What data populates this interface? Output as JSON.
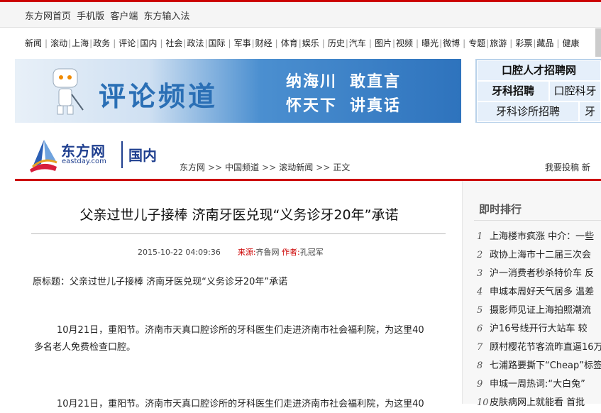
{
  "topbar": {
    "links": [
      "东方网首页",
      "手机版",
      "客户端",
      "东方输入法"
    ]
  },
  "nav": {
    "groups": [
      [
        "新闻"
      ],
      [
        "滚动",
        "上海",
        "政务"
      ],
      [
        "评论",
        "国内"
      ],
      [
        "社会",
        "政法",
        "国际"
      ],
      [
        "军事",
        "财经"
      ],
      [
        "体育",
        "娱乐"
      ],
      [
        "历史",
        "汽车"
      ],
      [
        "图片",
        "视频"
      ],
      [
        "曝光",
        "微博"
      ],
      [
        "专题",
        "旅游"
      ],
      [
        "彩票",
        "藏品"
      ],
      [
        "健康"
      ]
    ]
  },
  "banner": {
    "title": "评论频道",
    "slogan_line1_a": "纳海川",
    "slogan_line1_b": "敢直言",
    "slogan_line2_a": "怀天下",
    "slogan_line2_b": "讲真话"
  },
  "ads": {
    "row1": "口腔人才招聘网",
    "row2a": "牙科招聘",
    "row2b": "口腔科牙",
    "row3a": "牙科诊所招聘",
    "row3b": "牙"
  },
  "logo": {
    "name": "东方网",
    "domain": "eastday.com",
    "channel": "国内"
  },
  "breadcrumb": [
    "东方网",
    "中国频道",
    "滚动新闻",
    "正文"
  ],
  "submit_label": "我要投稿",
  "submit_tail": "新",
  "article": {
    "headline": "父亲过世儿子接棒 济南牙医兑现“义务诊牙20年”承诺",
    "date": "2015-10-22 04:09:36",
    "source_label": "来源:",
    "source": "齐鲁网",
    "author_label": "作者:",
    "author": "孔冠军",
    "original_title": "原标题：父亲过世儿子接棒 济南牙医兑现“义务诊牙20年”承诺",
    "para1_line1": "10月21日，重阳节。济南市天真口腔诊所的牙科医生们走进济南市社会福利院，为这里40",
    "para1_line2": "多名老人免费检查口腔。",
    "para2_line1": "10月21日，重阳节。济南市天真口腔诊所的牙科医生们走进济南市社会福利院，为这里40"
  },
  "sidebar": {
    "title": "即时排行",
    "items": [
      {
        "num": "1",
        "text": "上海楼市疯涨 中介：一些"
      },
      {
        "num": "2",
        "text": "政协上海市十二届三次会"
      },
      {
        "num": "3",
        "text": "沪一消费者秒杀特价车 反"
      },
      {
        "num": "4",
        "text": "申城本周好天气居多 温差"
      },
      {
        "num": "5",
        "text": "摄影师见证上海拍照潮流"
      },
      {
        "num": "6",
        "text": "沪16号线开行大站车 较"
      },
      {
        "num": "7",
        "text": "顾村樱花节客流昨直逼16万"
      },
      {
        "num": "8",
        "text": "七浦路要撕下“Cheap”标签"
      },
      {
        "num": "9",
        "text": "申城一周热词:“大白兔”"
      },
      {
        "num": "10",
        "text": "皮肤病网上就能看 首批"
      }
    ]
  },
  "colors": {
    "accent_red": "#cc0000",
    "brand_blue": "#1f3f8f",
    "banner_blue": "#2e73bd"
  }
}
